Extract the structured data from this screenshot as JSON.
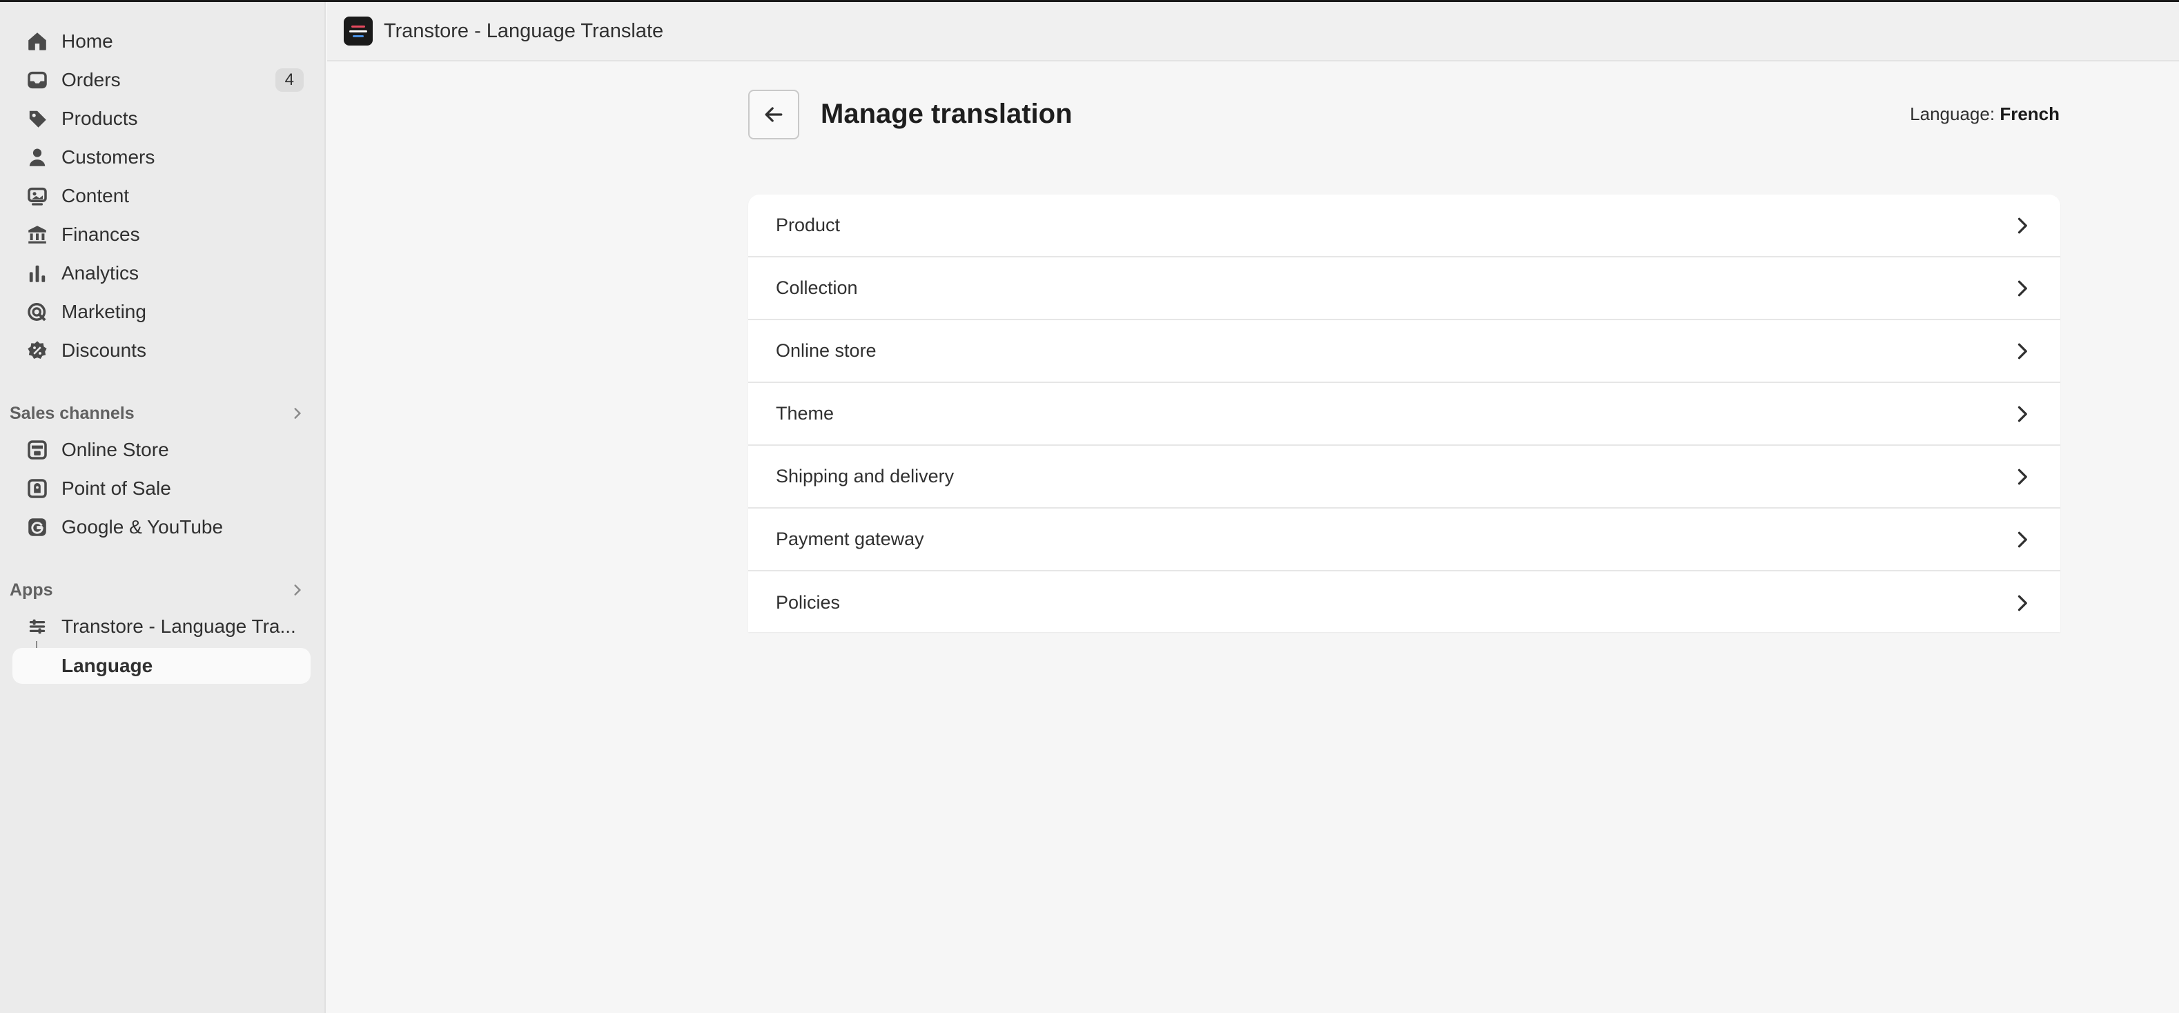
{
  "sidebar": {
    "nav": [
      {
        "label": "Home",
        "icon": "home-icon"
      },
      {
        "label": "Orders",
        "icon": "inbox-icon",
        "badge": "4"
      },
      {
        "label": "Products",
        "icon": "tag-icon"
      },
      {
        "label": "Customers",
        "icon": "person-icon"
      },
      {
        "label": "Content",
        "icon": "image-icon"
      },
      {
        "label": "Finances",
        "icon": "bank-icon"
      },
      {
        "label": "Analytics",
        "icon": "bar-chart-icon"
      },
      {
        "label": "Marketing",
        "icon": "target-icon"
      },
      {
        "label": "Discounts",
        "icon": "discount-icon"
      }
    ],
    "sales_channels": {
      "heading": "Sales channels",
      "items": [
        {
          "label": "Online Store",
          "icon": "storefront-icon"
        },
        {
          "label": "Point of Sale",
          "icon": "pos-icon"
        },
        {
          "label": "Google & YouTube",
          "icon": "google-icon"
        }
      ]
    },
    "apps": {
      "heading": "Apps",
      "app_label": "Transtore - Language Tra...",
      "sub_label": "Language"
    }
  },
  "appbar": {
    "title": "Transtore - Language Translate"
  },
  "main": {
    "title": "Manage translation",
    "language_prefix": "Language:",
    "language_value": "French",
    "rows": [
      {
        "label": "Product"
      },
      {
        "label": "Collection"
      },
      {
        "label": "Online store"
      },
      {
        "label": "Theme"
      },
      {
        "label": "Shipping and delivery"
      },
      {
        "label": "Payment gateway"
      },
      {
        "label": "Policies"
      }
    ]
  },
  "colors": {
    "sidebar_bg": "#ebebeb",
    "page_bg": "#f6f6f6",
    "card_bg": "#ffffff",
    "text": "#303030"
  }
}
